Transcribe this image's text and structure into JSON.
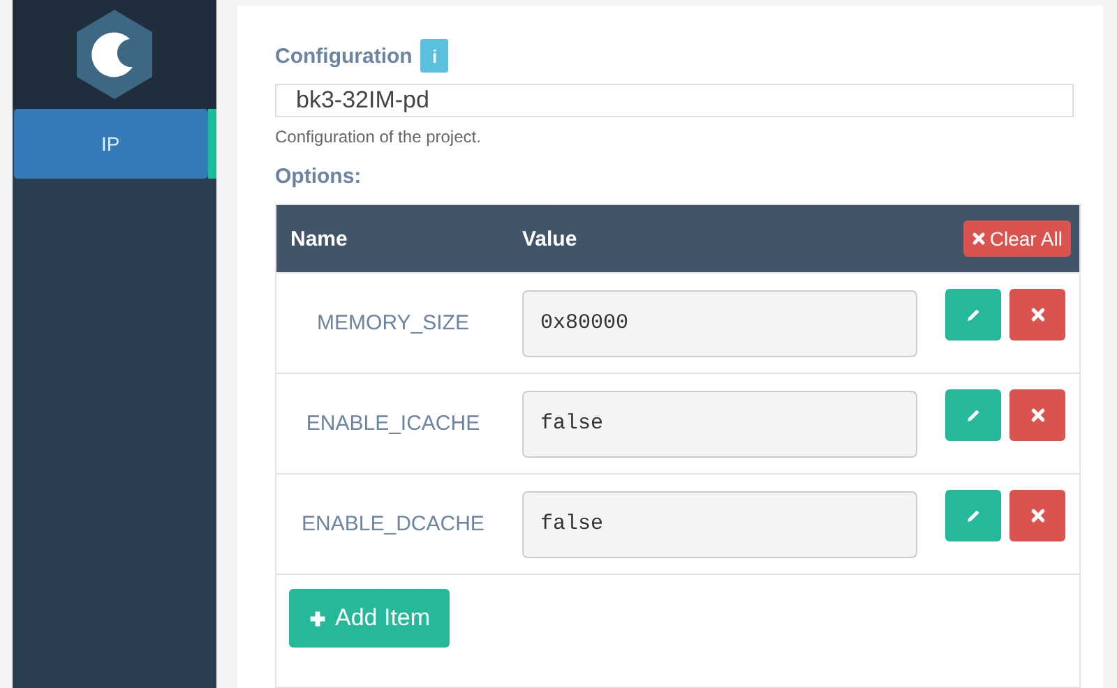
{
  "sidebar": {
    "items": [
      {
        "label": "IP",
        "selected": true
      }
    ]
  },
  "configuration": {
    "label": "Configuration",
    "info": "i",
    "value": "bk3-32IM-pd",
    "help": "Configuration of the project."
  },
  "options": {
    "label": "Options:",
    "columns": [
      "Name",
      "Value"
    ],
    "clear_all": "Clear All",
    "rows": [
      {
        "name": "MEMORY_SIZE",
        "value": "0x80000"
      },
      {
        "name": "ENABLE_ICACHE",
        "value": "false"
      },
      {
        "name": "ENABLE_DCACHE",
        "value": "false"
      }
    ],
    "add_item": "Add Item"
  }
}
